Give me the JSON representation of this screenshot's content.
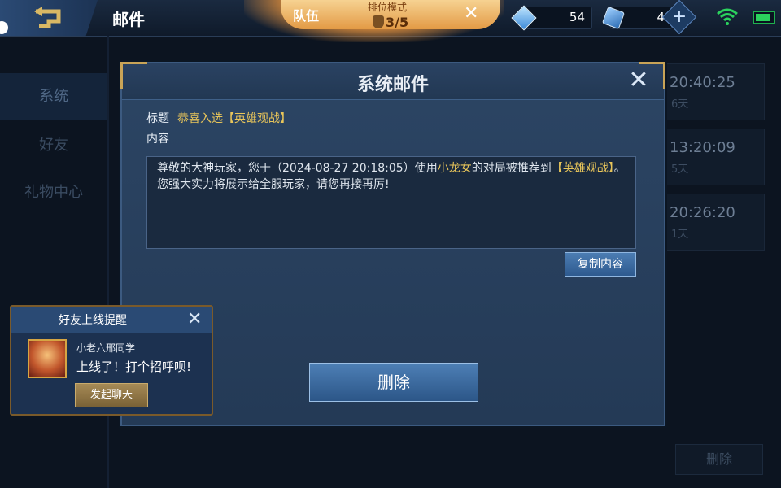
{
  "header": {
    "title": "邮件",
    "team_label": "队伍",
    "rank_mode": "排位模式",
    "rank_progress": "3/5",
    "diamonds": "54",
    "coupons": "4"
  },
  "sidebar": {
    "tabs": [
      {
        "label": "系统"
      },
      {
        "label": "好友"
      },
      {
        "label": "礼物中心"
      }
    ]
  },
  "mail_list": [
    {
      "time": "20:40:25",
      "days": "6天"
    },
    {
      "time": "13:20:09",
      "days": "5天"
    },
    {
      "time": "20:26:20",
      "days": "1天"
    }
  ],
  "background_delete_label": "删除",
  "dialog": {
    "title": "系统邮件",
    "subject_label": "标题",
    "subject": "恭喜入选【英雄观战】",
    "content_label": "内容",
    "content": {
      "part1": "尊敬的大神玩家，您于（2024-08-27 20:18:05）使用",
      "hero": "小龙女",
      "part2": "的对局被推荐到",
      "feature": "【英雄观战】",
      "part3": "。",
      "line2": "您强大实力将展示给全服玩家，请您再接再厉!"
    },
    "copy_label": "复制内容",
    "delete_label": "删除"
  },
  "friend_toast": {
    "title": "好友上线提醒",
    "friend_name": "小老六邢同学",
    "message": "上线了！打个招呼呗!",
    "chat_label": "发起聊天"
  },
  "colors": {
    "accent_gold": "#e8c55a",
    "button_blue": "#3c6ca2",
    "wifi_green": "#2bd35d"
  }
}
